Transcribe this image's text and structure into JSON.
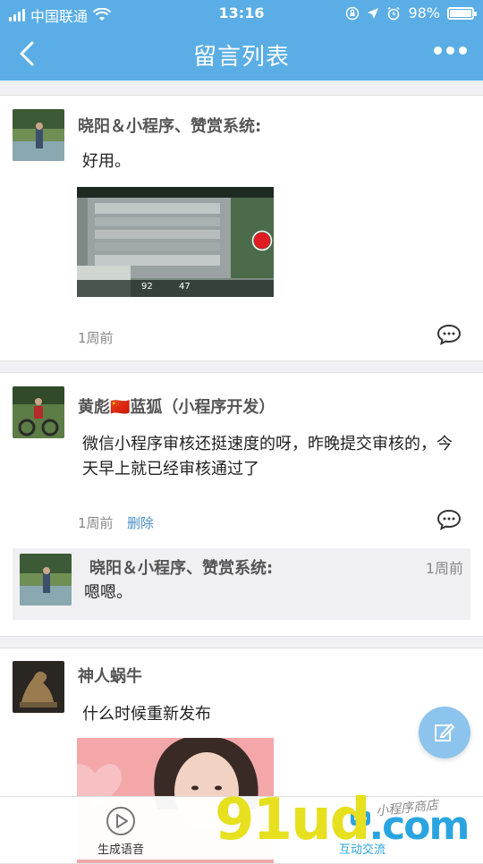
{
  "status_bar": {
    "carrier": "中国联通",
    "time": "13:16",
    "battery": "98%",
    "battery_level": 0.98
  },
  "nav": {
    "title": "留言列表",
    "back_icon": "chevron-left-icon",
    "more_icon": "more-dots-icon"
  },
  "messages": [
    {
      "author": "晓阳＆小程序、赞赏系统:",
      "content": "好用。",
      "time": "1周前",
      "image_osd_left": "92",
      "image_osd_right": "47"
    },
    {
      "author": "黄彪🇨🇳蓝狐（小程序开发）",
      "content": "微信小程序审核还挺速度的呀，昨晚提交审核的，今天早上就已经审核通过了",
      "time": "1周前",
      "delete_label": "删除",
      "reply": {
        "author": "晓阳＆小程序、赞赏系统:",
        "time": "1周前",
        "content": "嗯嗯。"
      }
    },
    {
      "author": "神人蜗牛",
      "content": "什么时候重新发布"
    }
  ],
  "tabbar": {
    "tab1_label": "生成语音",
    "tab2_label": "互动交流"
  },
  "watermark": {
    "text_a": "91ud",
    "text_b": ".com",
    "small": "小程序商店"
  },
  "colors": {
    "primary": "#5aaee5",
    "link": "#4a90c8",
    "fab": "#8cc4ee"
  }
}
